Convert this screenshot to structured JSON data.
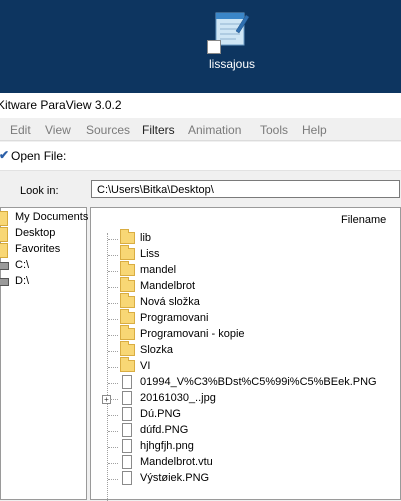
{
  "desktop": {
    "icon_label": "lissajous"
  },
  "window": {
    "title": "Kitware ParaView 3.0.2"
  },
  "menu": {
    "items": [
      "Edit",
      "View",
      "Sources",
      "Filters",
      "Animation",
      "Tools",
      "Help"
    ]
  },
  "dialog": {
    "title": "Open File:",
    "look_in_label": "Look in:",
    "path": "C:\\Users\\Bitka\\Desktop\\",
    "column_header": "Filename"
  },
  "sidebar": {
    "items": [
      {
        "label": "My Documents",
        "icon": "folder-icon"
      },
      {
        "label": "Desktop",
        "icon": "folder-icon"
      },
      {
        "label": "Favorites",
        "icon": "folder-icon"
      },
      {
        "label": "C:\\",
        "icon": "drive-icon"
      },
      {
        "label": "D:\\",
        "icon": "drive-icon"
      }
    ]
  },
  "files": [
    {
      "name": "lib",
      "type": "folder"
    },
    {
      "name": "Liss",
      "type": "folder"
    },
    {
      "name": "mandel",
      "type": "folder"
    },
    {
      "name": "Mandelbrot",
      "type": "folder"
    },
    {
      "name": "Nová složka",
      "type": "folder"
    },
    {
      "name": "Programovani",
      "type": "folder"
    },
    {
      "name": "Programovani - kopie",
      "type": "folder"
    },
    {
      "name": "Slozka",
      "type": "folder"
    },
    {
      "name": "VI",
      "type": "folder"
    },
    {
      "name": "01994_V%C3%BDst%C5%99i%C5%BEek.PNG",
      "type": "file"
    },
    {
      "name": "20161030_..jpg",
      "type": "file",
      "expandable": true
    },
    {
      "name": "Dú.PNG",
      "type": "file"
    },
    {
      "name": "dúfd.PNG",
      "type": "file"
    },
    {
      "name": "hjhgfjh.png",
      "type": "file"
    },
    {
      "name": "Mandelbrot.vtu",
      "type": "file"
    },
    {
      "name": "Výstøiek.PNG",
      "type": "file"
    }
  ],
  "colors": {
    "desktop_bg": "#0d3560",
    "folder": "#f8d775",
    "accent": "#2b5fa8"
  }
}
